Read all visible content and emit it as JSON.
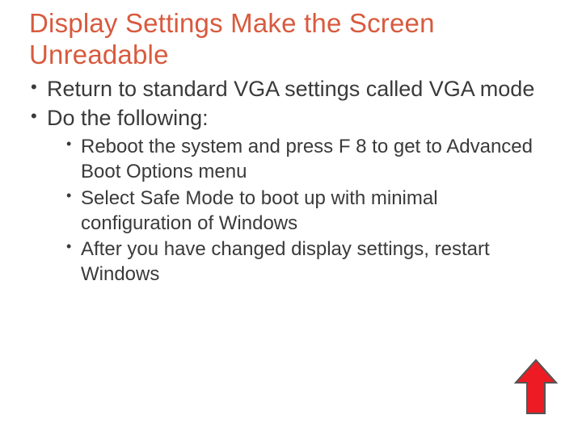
{
  "title": "Display Settings Make the Screen Unreadable",
  "bullets_level1": {
    "b0": "Return to standard VGA settings called VGA mode",
    "b1": "Do the following:"
  },
  "bullets_level2": {
    "s0": "Reboot the system and press F 8 to get to Advanced Boot Options menu",
    "s1": "Select Safe Mode to boot up with minimal configuration of Windows",
    "s2": "After you have changed display settings, restart Windows"
  },
  "arrow": {
    "fill": "#ed1c24",
    "stroke": "#555555"
  }
}
